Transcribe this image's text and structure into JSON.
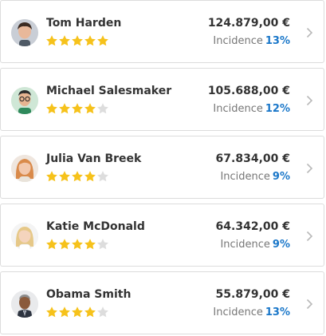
{
  "people": [
    {
      "name": "Tom Harden",
      "rating": 5,
      "amount": "124.879,00 €",
      "incidence_label": "Incidence",
      "incidence_value": "13%",
      "avatar": "man-dark-hair-icon"
    },
    {
      "name": "Michael Salesmaker",
      "rating": 4,
      "amount": "105.688,00 €",
      "incidence_label": "Incidence",
      "incidence_value": "12%",
      "avatar": "man-glasses-icon"
    },
    {
      "name": "Julia Van Breek",
      "rating": 4,
      "amount": "67.834,00 €",
      "incidence_label": "Incidence",
      "incidence_value": "9%",
      "avatar": "woman-red-hair-icon"
    },
    {
      "name": "Katie McDonald",
      "rating": 4,
      "amount": "64.342,00 €",
      "incidence_label": "Incidence",
      "incidence_value": "9%",
      "avatar": "woman-blonde-hair-icon"
    },
    {
      "name": "Obama Smith",
      "rating": 4,
      "amount": "55.879,00 €",
      "incidence_label": "Incidence",
      "incidence_value": "13%",
      "avatar": "man-suit-icon"
    }
  ],
  "max_rating": 5,
  "colors": {
    "star_filled": "#f6c21b",
    "star_empty": "#dddddd",
    "accent": "#1a77c9"
  }
}
